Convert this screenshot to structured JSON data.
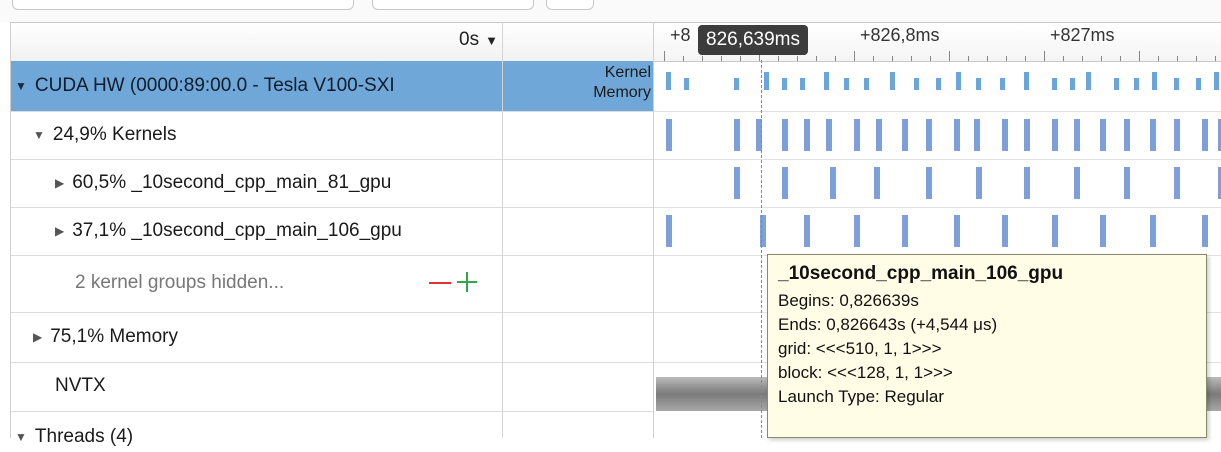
{
  "header": {
    "time_dropdown": "0s"
  },
  "rows": {
    "cuda_hw": "CUDA HW (0000:89:00.0 - Tesla V100-SXI",
    "kernel_label": "Kernel",
    "memory_label": "Memory",
    "kernels": "24,9% Kernels",
    "main81": "60,5% _10second_cpp_main_81_gpu",
    "main106": "37,1% _10second_cpp_main_106_gpu",
    "hidden": "2 kernel groups hidden...",
    "memory": "75,1% Memory",
    "nvtx": "NVTX",
    "threads": "Threads (4)"
  },
  "ruler": {
    "first": "+8",
    "mid": "+826,8ms",
    "last": "+827ms",
    "cursor": "826,639ms"
  },
  "tooltip": {
    "title": "_10second_cpp_main_106_gpu",
    "begins": "Begins: 0,826639s",
    "ends": "Ends: 0,826643s (+4,544 μs)",
    "grid": "grid:  <<<510, 1, 1>>>",
    "block": "block: <<<128, 1, 1>>>",
    "launch": "Launch Type: Regular"
  },
  "colors": {
    "selection": "#6fa8d8",
    "kernel_bar": "#7f9fdb",
    "minus": "#e03030",
    "plus": "#2fa84a"
  }
}
